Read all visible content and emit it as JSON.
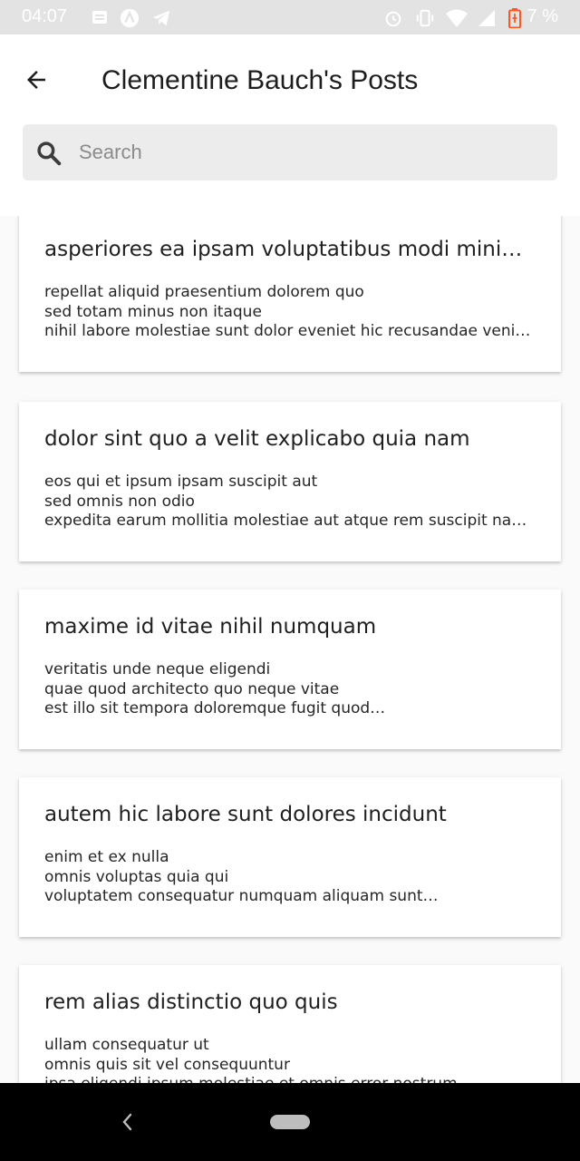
{
  "status_bar": {
    "time": "04:07",
    "battery_percent": "7 %",
    "icons": [
      "notification-icon",
      "app-icon",
      "telegram-icon",
      "alarm-icon",
      "vibrate-icon",
      "wifi-icon",
      "signal-icon",
      "battery-icon"
    ]
  },
  "header": {
    "title": "Clementine Bauch's Posts",
    "back_icon": "arrow-left-icon"
  },
  "search": {
    "placeholder": "Search",
    "value": ""
  },
  "posts": [
    {
      "title": "asperiores ea ipsam voluptatibus modi minima quia sint",
      "lines": [
        "repellat aliquid praesentium dolorem quo",
        "sed totam minus non itaque",
        "nihil labore molestiae sunt dolor eveniet hic recusandae veniam"
      ]
    },
    {
      "title": "dolor sint quo a velit explicabo quia nam",
      "lines": [
        "eos qui et ipsum ipsam suscipit aut",
        "sed omnis non odio",
        "expedita earum mollitia molestiae aut atque rem suscipit nam impedit"
      ]
    },
    {
      "title": "maxime id vitae nihil numquam",
      "lines": [
        "veritatis unde neque eligendi",
        "quae quod architecto quo neque vitae",
        "est illo sit tempora doloremque fugit quod…"
      ]
    },
    {
      "title": "autem hic labore sunt dolores incidunt",
      "lines": [
        "enim et ex nulla",
        "omnis voluptas quia qui",
        "voluptatem consequatur numquam aliquam sunt…"
      ]
    },
    {
      "title": "rem alias distinctio quo quis",
      "lines": [
        "ullam consequatur ut",
        "omnis quis sit vel consequuntur",
        "ipsa eligendi ipsum molestiae et omnis error nostrum"
      ]
    }
  ],
  "colors": {
    "status_bar_bg": "#e3e3e3",
    "search_bg": "#ececec",
    "nav_bar_bg": "#000000",
    "battery_low": "#ff5722"
  }
}
